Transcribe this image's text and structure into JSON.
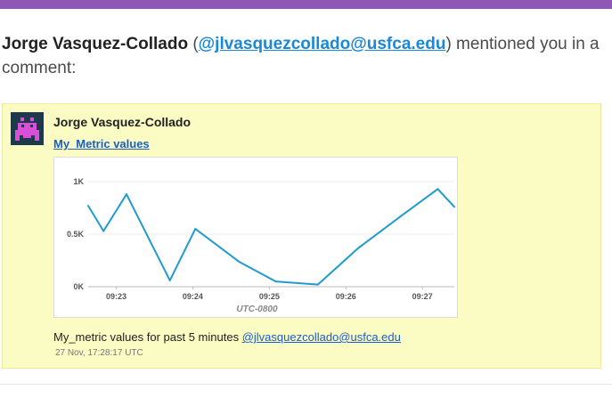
{
  "header": {
    "author": "Jorge Vasquez-Collado",
    "open_paren": " (",
    "mention": "@jlvasquezcollado@usfca.edu",
    "close_paren": ")",
    "tail": " mentioned you in a comment:"
  },
  "card": {
    "author": "Jorge Vasquez-Collado",
    "link_text": "My_Metric values",
    "message_text": "My_metric values for past 5 minutes ",
    "message_mention": "@jlvasquezcollado@usfca.edu",
    "timestamp": "27 Nov, 17:28:17 UTC"
  },
  "avatar": {
    "bg": "#1e3a4a",
    "fg": "#d94fd9",
    "icon": "pixel-invader-icon"
  },
  "colors": {
    "top_bar": "#8e59b4",
    "card_bg": "#fbfbc4",
    "line": "#1f9bd1",
    "link": "#1a5fc8"
  },
  "chart_data": {
    "type": "line",
    "x": [
      "09:22:38",
      "09:22:50",
      "09:23:08",
      "09:23:42",
      "09:24:02",
      "09:24:36",
      "09:25:05",
      "09:25:38",
      "09:26:10",
      "09:26:44",
      "09:27:12",
      "09:27:25"
    ],
    "y": [
      770,
      530,
      880,
      60,
      550,
      240,
      50,
      20,
      370,
      680,
      930,
      760
    ],
    "x_ticks": [
      "09:23",
      "09:24",
      "09:25",
      "09:26",
      "09:27"
    ],
    "y_ticks": [
      "0K",
      "0.5K",
      "1K"
    ],
    "ylim": [
      0,
      1000
    ],
    "xlabel": "UTC-0800",
    "grid": true
  }
}
